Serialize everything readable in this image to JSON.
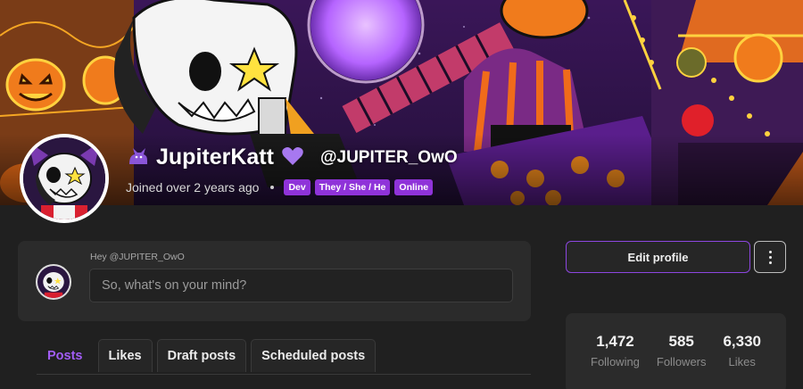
{
  "profile": {
    "display_name": "JupiterKatt",
    "handle": "@JUPITER_OwO",
    "joined": "Joined over 2 years ago",
    "badges": [
      "Dev",
      "They / She / He",
      "Online"
    ],
    "name_icons": [
      "cat-icon",
      "purple-heart-icon"
    ]
  },
  "composer": {
    "greeting": "Hey @JUPITER_OwO",
    "placeholder": "So, what's on your mind?"
  },
  "tabs": [
    {
      "label": "Posts",
      "active": true
    },
    {
      "label": "Likes",
      "active": false
    },
    {
      "label": "Draft posts",
      "active": false
    },
    {
      "label": "Scheduled posts",
      "active": false
    }
  ],
  "actions": {
    "edit_label": "Edit profile",
    "more_icon": "more-vertical-icon"
  },
  "stats": [
    {
      "value": "1,472",
      "label": "Following"
    },
    {
      "value": "585",
      "label": "Followers"
    },
    {
      "value": "6,330",
      "label": "Likes"
    }
  ],
  "colors": {
    "accent": "#8f33d9",
    "background": "#202020",
    "panel": "#2b2b2b"
  }
}
